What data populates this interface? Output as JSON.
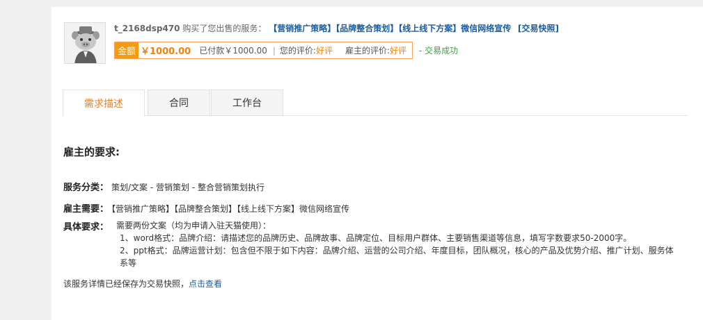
{
  "header": {
    "buyer_name": "t_2168dsp470",
    "action_text": "购买了您出售的服务：",
    "service_title": "【营销推广策略】【品牌整合策划】【线上线下方案】微信网络宣传",
    "snapshot_link": "[交易快照]",
    "amount_label": "金额",
    "amount_value": "￥1000.00",
    "paid_text": "已付款￥1000.00",
    "separator": "|",
    "your_rating_label": "您的评价:",
    "your_rating_value": "好评",
    "employer_rating_label": "雇主的评价:",
    "employer_rating_value": "好评",
    "status": "- 交易成功",
    "avatar_icon": "pig-avatar-icon"
  },
  "tabs": [
    {
      "label": "需求描述",
      "active": true
    },
    {
      "label": "合同",
      "active": false
    },
    {
      "label": "工作台",
      "active": false
    }
  ],
  "body": {
    "title": "雇主的要求:",
    "category_label": "服务分类：",
    "category_value": "策划/文案 - 营销策划 - 整合营销策划执行",
    "need_label": "雇主需要：",
    "need_value": "【营销推广策略】【品牌整合策划】【线上线下方案】微信网络宣传",
    "detail_label": "具体要求：",
    "detail_lines": [
      "需要两份文案（均为申请入驻天猫使用）：",
      "1、word格式：品牌介绍：请描述您的品牌历史、品牌故事、品牌定位、目标用户群体、主要销售渠道等信息，填写字数要求50-2000字。",
      "2、ppt格式：品牌运营计划：包含但不限于如下内容：品牌介绍、运营的公司介绍、年度目标，团队概况，核心的产品及优势介绍、推广计划、服务体系等"
    ],
    "footer_text": "该服务详情已经保存为交易快照，",
    "footer_link": "点击查看"
  },
  "colors": {
    "accent_orange": "#f39c12",
    "link_blue": "#1a5d9e",
    "success_green": "#3aa33a"
  }
}
